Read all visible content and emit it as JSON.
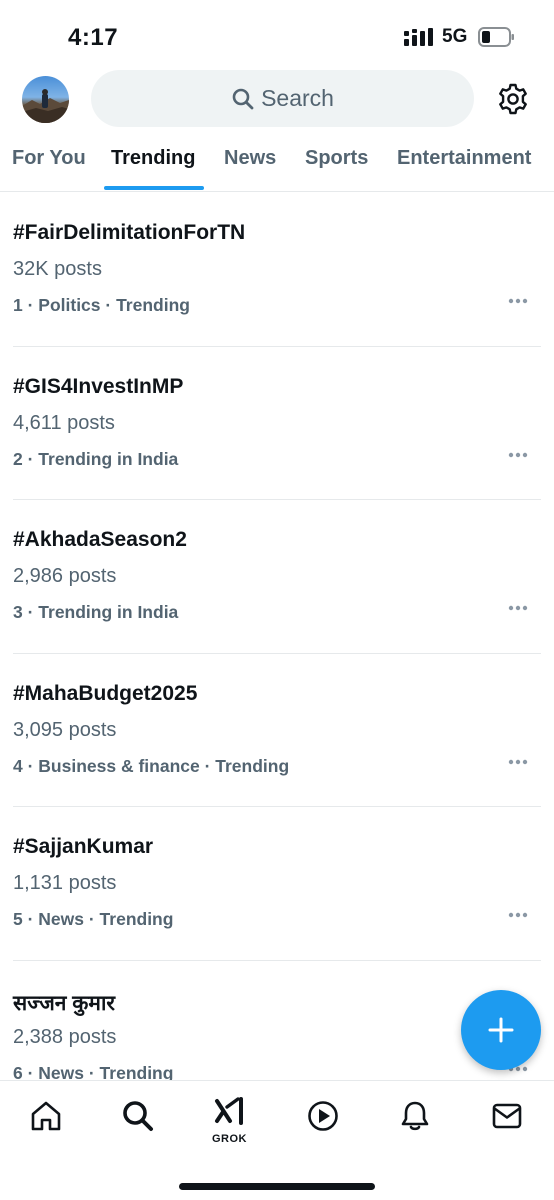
{
  "status_bar": {
    "time": "4:17",
    "network": "5G",
    "icons": [
      "signal-icon",
      "battery-icon"
    ]
  },
  "header": {
    "search_placeholder": "Search",
    "icons": [
      "avatar",
      "search-icon",
      "settings-gear-icon"
    ]
  },
  "tabs": [
    {
      "label": "For You",
      "active": false
    },
    {
      "label": "Trending",
      "active": true
    },
    {
      "label": "News",
      "active": false
    },
    {
      "label": "Sports",
      "active": false
    },
    {
      "label": "Entertainment",
      "active": false
    }
  ],
  "trends": [
    {
      "name": "#FairDelimitationForTN",
      "posts": "32K posts",
      "meta": "1 · Politics · Trending"
    },
    {
      "name": "#GIS4InvestInMP",
      "posts": "4,611 posts",
      "meta": "2 · Trending in India"
    },
    {
      "name": "#AkhadaSeason2",
      "posts": "2,986 posts",
      "meta": "3 · Trending in India"
    },
    {
      "name": "#MahaBudget2025",
      "posts": "3,095 posts",
      "meta": "4 · Business & finance · Trending"
    },
    {
      "name": "#SajjanKumar",
      "posts": "1,131 posts",
      "meta": "5 · News · Trending"
    },
    {
      "name": "सज्जन कुमार",
      "posts": "2,388 posts",
      "meta": "6 · News · Trending"
    }
  ],
  "bottom_nav": {
    "grok_label": "GROK",
    "icons": [
      "home-icon",
      "search-icon",
      "grok-icon",
      "video-play-icon",
      "notifications-bell-icon",
      "messages-envelope-icon"
    ]
  },
  "colors": {
    "accent": "#1d9bf0",
    "text_primary": "#0f1419",
    "text_secondary": "#536471",
    "divider": "#e6e9eb",
    "search_bg": "#eff3f4"
  }
}
